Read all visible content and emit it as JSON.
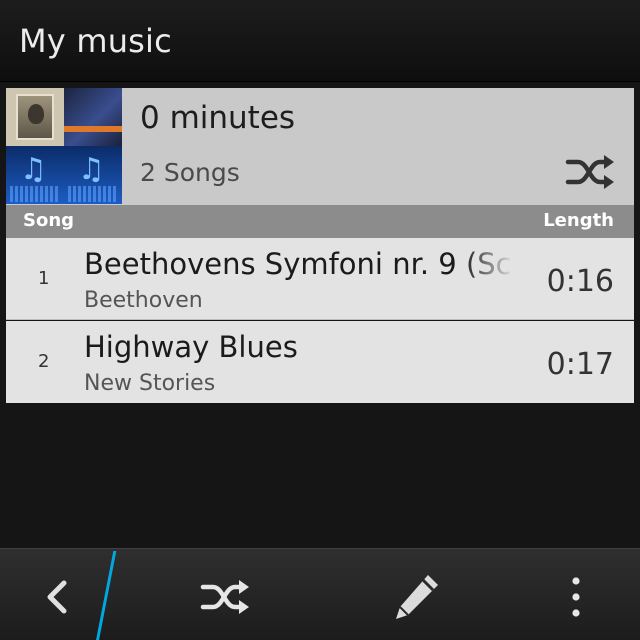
{
  "app": {
    "title": "My music"
  },
  "playlist": {
    "duration": "0 minutes",
    "song_count": "2 Songs",
    "shuffle_icon": "shuffle-icon"
  },
  "columns": {
    "song": "Song",
    "length": "Length"
  },
  "songs": [
    {
      "number": "1",
      "title": "Beethovens Symfoni nr. 9 (Sc",
      "artist": "Beethoven",
      "length": "0:16"
    },
    {
      "number": "2",
      "title": "Highway Blues",
      "artist": "New Stories",
      "length": "0:17"
    }
  ],
  "toolbar": {
    "back_icon": "back-icon",
    "shuffle_icon": "shuffle-icon",
    "edit_icon": "pencil-icon",
    "more_icon": "overflow-menu-icon"
  },
  "colors": {
    "accent": "#00a8df",
    "header_card": "#c9c9c9",
    "column_header": "#8c8c8c",
    "row_bg": "#e3e3e3"
  }
}
